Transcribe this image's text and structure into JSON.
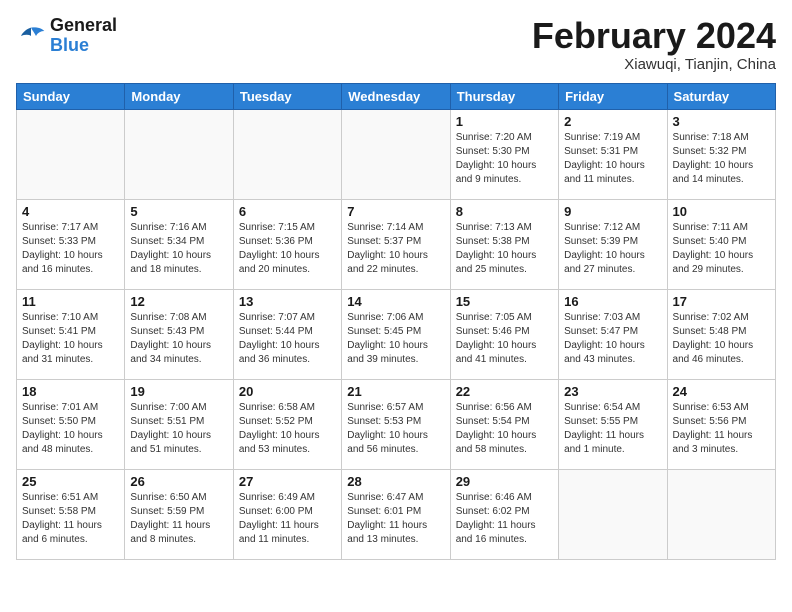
{
  "logo": {
    "text_general": "General",
    "text_blue": "Blue"
  },
  "header": {
    "month_title": "February 2024",
    "location": "Xiawuqi, Tianjin, China"
  },
  "weekdays": [
    "Sunday",
    "Monday",
    "Tuesday",
    "Wednesday",
    "Thursday",
    "Friday",
    "Saturday"
  ],
  "weeks": [
    [
      {
        "day": "",
        "empty": true
      },
      {
        "day": "",
        "empty": true
      },
      {
        "day": "",
        "empty": true
      },
      {
        "day": "",
        "empty": true
      },
      {
        "day": "1",
        "sunrise": "7:20 AM",
        "sunset": "5:30 PM",
        "daylight": "10 hours and 9 minutes."
      },
      {
        "day": "2",
        "sunrise": "7:19 AM",
        "sunset": "5:31 PM",
        "daylight": "10 hours and 11 minutes."
      },
      {
        "day": "3",
        "sunrise": "7:18 AM",
        "sunset": "5:32 PM",
        "daylight": "10 hours and 14 minutes."
      }
    ],
    [
      {
        "day": "4",
        "sunrise": "7:17 AM",
        "sunset": "5:33 PM",
        "daylight": "10 hours and 16 minutes."
      },
      {
        "day": "5",
        "sunrise": "7:16 AM",
        "sunset": "5:34 PM",
        "daylight": "10 hours and 18 minutes."
      },
      {
        "day": "6",
        "sunrise": "7:15 AM",
        "sunset": "5:36 PM",
        "daylight": "10 hours and 20 minutes."
      },
      {
        "day": "7",
        "sunrise": "7:14 AM",
        "sunset": "5:37 PM",
        "daylight": "10 hours and 22 minutes."
      },
      {
        "day": "8",
        "sunrise": "7:13 AM",
        "sunset": "5:38 PM",
        "daylight": "10 hours and 25 minutes."
      },
      {
        "day": "9",
        "sunrise": "7:12 AM",
        "sunset": "5:39 PM",
        "daylight": "10 hours and 27 minutes."
      },
      {
        "day": "10",
        "sunrise": "7:11 AM",
        "sunset": "5:40 PM",
        "daylight": "10 hours and 29 minutes."
      }
    ],
    [
      {
        "day": "11",
        "sunrise": "7:10 AM",
        "sunset": "5:41 PM",
        "daylight": "10 hours and 31 minutes."
      },
      {
        "day": "12",
        "sunrise": "7:08 AM",
        "sunset": "5:43 PM",
        "daylight": "10 hours and 34 minutes."
      },
      {
        "day": "13",
        "sunrise": "7:07 AM",
        "sunset": "5:44 PM",
        "daylight": "10 hours and 36 minutes."
      },
      {
        "day": "14",
        "sunrise": "7:06 AM",
        "sunset": "5:45 PM",
        "daylight": "10 hours and 39 minutes."
      },
      {
        "day": "15",
        "sunrise": "7:05 AM",
        "sunset": "5:46 PM",
        "daylight": "10 hours and 41 minutes."
      },
      {
        "day": "16",
        "sunrise": "7:03 AM",
        "sunset": "5:47 PM",
        "daylight": "10 hours and 43 minutes."
      },
      {
        "day": "17",
        "sunrise": "7:02 AM",
        "sunset": "5:48 PM",
        "daylight": "10 hours and 46 minutes."
      }
    ],
    [
      {
        "day": "18",
        "sunrise": "7:01 AM",
        "sunset": "5:50 PM",
        "daylight": "10 hours and 48 minutes."
      },
      {
        "day": "19",
        "sunrise": "7:00 AM",
        "sunset": "5:51 PM",
        "daylight": "10 hours and 51 minutes."
      },
      {
        "day": "20",
        "sunrise": "6:58 AM",
        "sunset": "5:52 PM",
        "daylight": "10 hours and 53 minutes."
      },
      {
        "day": "21",
        "sunrise": "6:57 AM",
        "sunset": "5:53 PM",
        "daylight": "10 hours and 56 minutes."
      },
      {
        "day": "22",
        "sunrise": "6:56 AM",
        "sunset": "5:54 PM",
        "daylight": "10 hours and 58 minutes."
      },
      {
        "day": "23",
        "sunrise": "6:54 AM",
        "sunset": "5:55 PM",
        "daylight": "11 hours and 1 minute."
      },
      {
        "day": "24",
        "sunrise": "6:53 AM",
        "sunset": "5:56 PM",
        "daylight": "11 hours and 3 minutes."
      }
    ],
    [
      {
        "day": "25",
        "sunrise": "6:51 AM",
        "sunset": "5:58 PM",
        "daylight": "11 hours and 6 minutes."
      },
      {
        "day": "26",
        "sunrise": "6:50 AM",
        "sunset": "5:59 PM",
        "daylight": "11 hours and 8 minutes."
      },
      {
        "day": "27",
        "sunrise": "6:49 AM",
        "sunset": "6:00 PM",
        "daylight": "11 hours and 11 minutes."
      },
      {
        "day": "28",
        "sunrise": "6:47 AM",
        "sunset": "6:01 PM",
        "daylight": "11 hours and 13 minutes."
      },
      {
        "day": "29",
        "sunrise": "6:46 AM",
        "sunset": "6:02 PM",
        "daylight": "11 hours and 16 minutes."
      },
      {
        "day": "",
        "empty": true
      },
      {
        "day": "",
        "empty": true
      }
    ]
  ]
}
